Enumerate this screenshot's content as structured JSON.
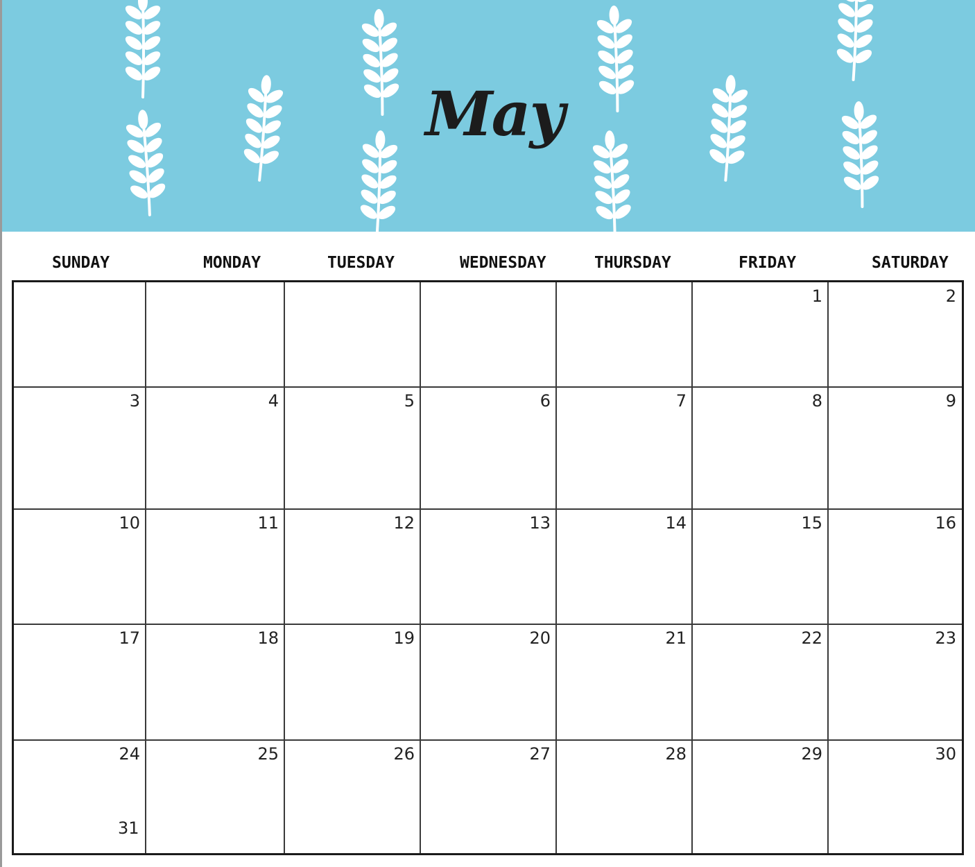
{
  "calendar": {
    "month": "May",
    "colors": {
      "banner": "#7ccbe0",
      "leaf": "#ffffff",
      "title": "#1c1c1c",
      "grid": "#1a1a1a"
    },
    "weekdays": [
      "SUNDAY",
      "MONDAY",
      "TUESDAY",
      "WEDNESDAY",
      "THURSDAY",
      "FRIDAY",
      "SATURDAY"
    ],
    "weeks": [
      [
        "",
        "",
        "",
        "",
        "",
        "1",
        "2"
      ],
      [
        "3",
        "4",
        "5",
        "6",
        "7",
        "8",
        "9"
      ],
      [
        "10",
        "11",
        "12",
        "13",
        "14",
        "15",
        "16"
      ],
      [
        "17",
        "18",
        "19",
        "20",
        "21",
        "22",
        "23"
      ],
      [
        "24",
        "25",
        "26",
        "27",
        "28",
        "29",
        "30"
      ]
    ],
    "extra_date": "31",
    "decoration_icon": "leaf-sprig-icon"
  }
}
